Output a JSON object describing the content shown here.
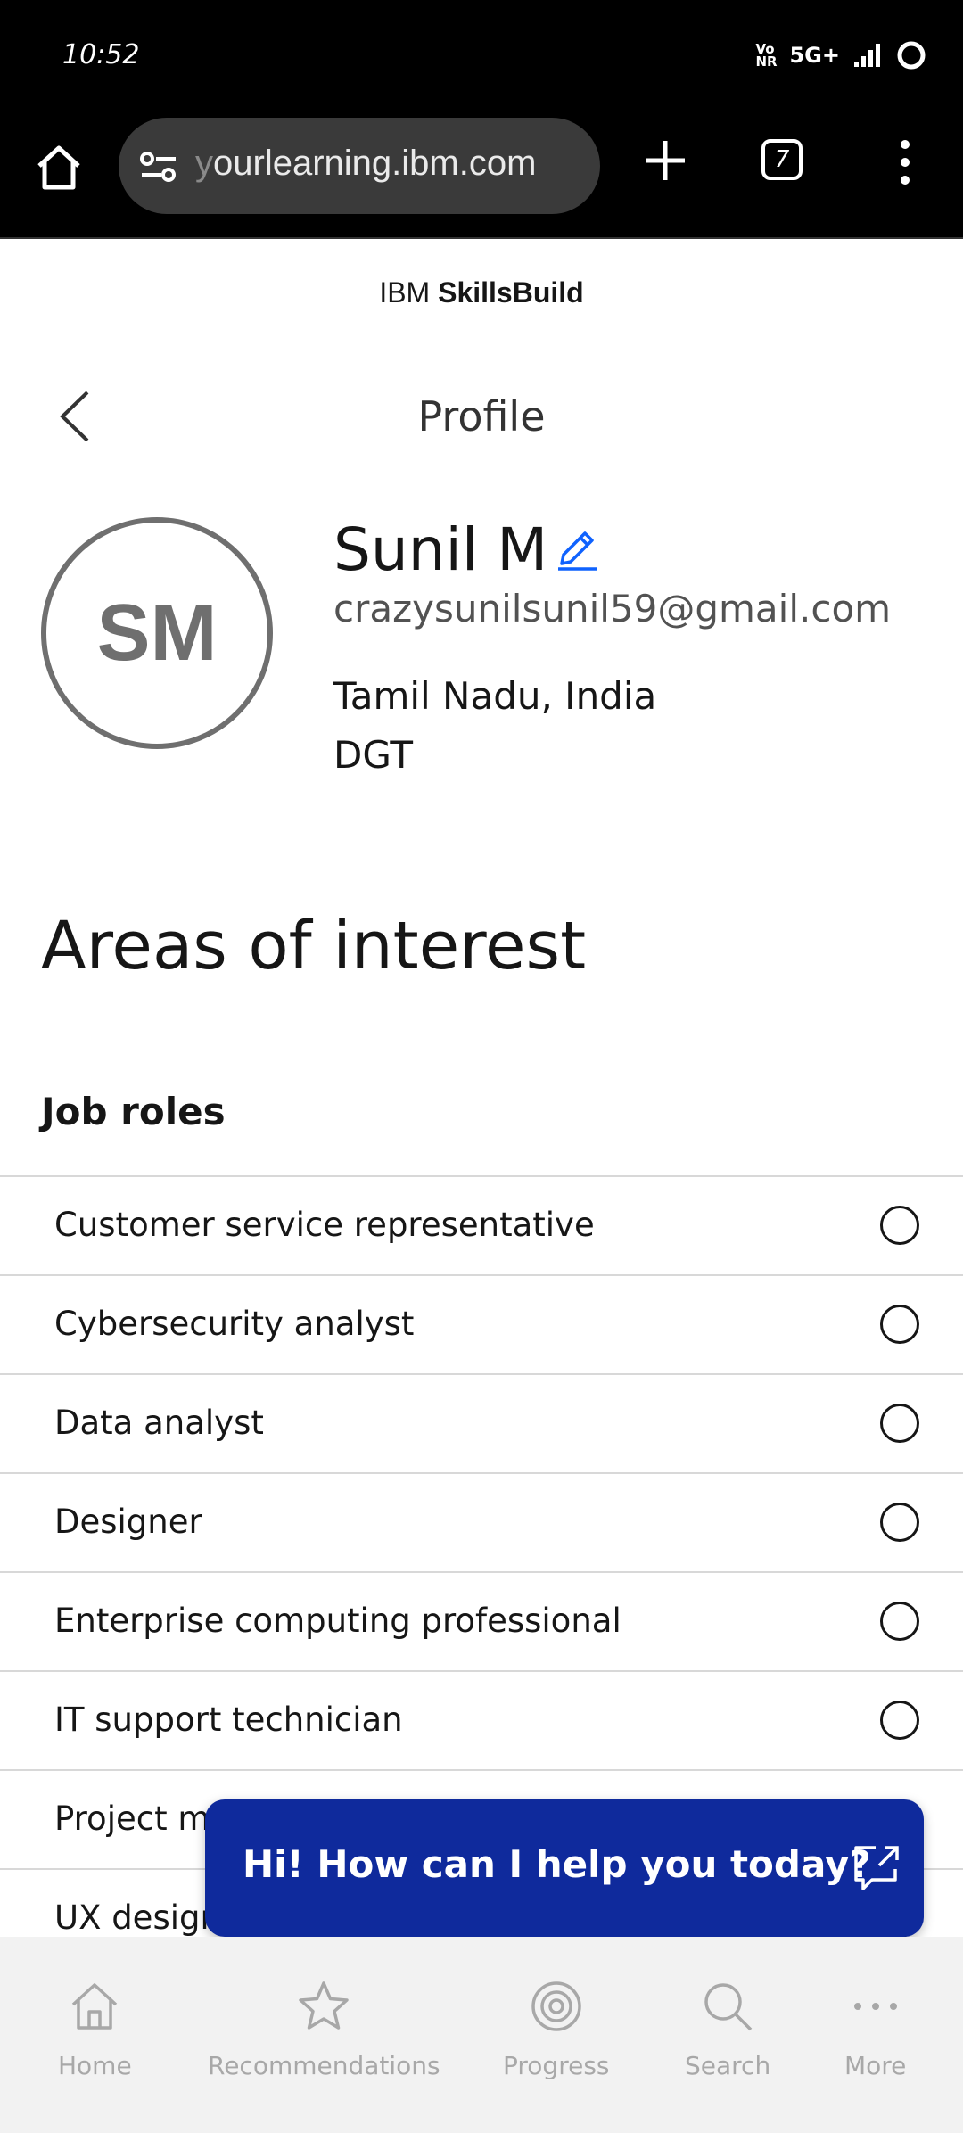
{
  "status_bar": {
    "time": "10:52",
    "volte": "Vo NR",
    "network": "5G+",
    "icons": [
      "signal-icon",
      "loading-icon"
    ]
  },
  "browser": {
    "url_prefix": "y",
    "url_rest": "ourlearning.ibm.com",
    "tab_count": "7",
    "icons": [
      "home-icon",
      "site-settings-icon",
      "plus-icon",
      "tabs-icon",
      "menu-icon"
    ]
  },
  "brand": {
    "prefix": "IBM",
    "name": "SkillsBuild"
  },
  "header": {
    "title": "Profile"
  },
  "profile": {
    "initials": "SM",
    "name": "Sunil M",
    "email": "crazysunilsunil59@gmail.com",
    "location": "Tamil Nadu, India",
    "organization": "DGT"
  },
  "interests": {
    "title": "Areas of interest",
    "job_roles_title": "Job roles",
    "job_roles": [
      {
        "label": "Customer service representative",
        "selected": false
      },
      {
        "label": "Cybersecurity analyst",
        "selected": false
      },
      {
        "label": "Data analyst",
        "selected": false
      },
      {
        "label": "Designer",
        "selected": false
      },
      {
        "label": "Enterprise computing professional",
        "selected": false
      },
      {
        "label": "IT support technician",
        "selected": false
      },
      {
        "label": "Project m",
        "selected": false
      },
      {
        "label": "UX designe",
        "selected": false
      }
    ]
  },
  "chat": {
    "label": "Hi! How can I help you today?",
    "color": "#0f2a9c"
  },
  "bottom_nav": [
    {
      "label": "Home",
      "icon": "home-icon"
    },
    {
      "label": "Recommendations",
      "icon": "star-icon"
    },
    {
      "label": "Progress",
      "icon": "progress-icon"
    },
    {
      "label": "Search",
      "icon": "search-icon"
    },
    {
      "label": "More",
      "icon": "more-icon"
    }
  ],
  "colors": {
    "accent": "#0f62fe",
    "text": "#161616",
    "muted": "#525252"
  }
}
